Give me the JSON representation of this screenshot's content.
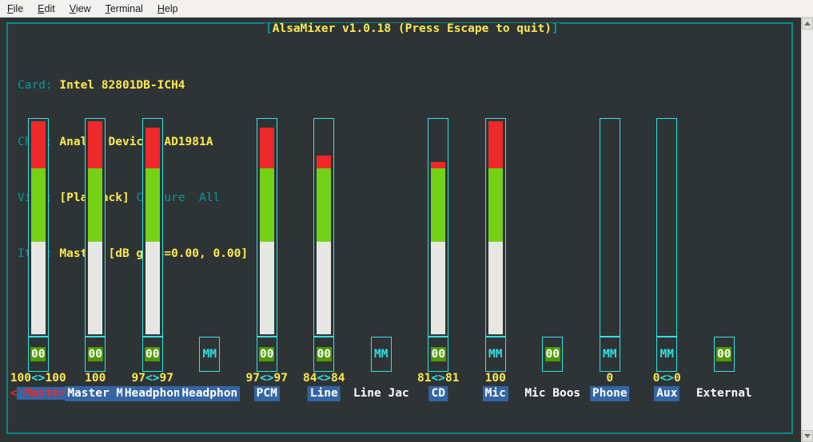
{
  "menu": {
    "items": [
      {
        "label": "File",
        "mnemonic": "F"
      },
      {
        "label": "Edit",
        "mnemonic": "E"
      },
      {
        "label": "View",
        "mnemonic": "V"
      },
      {
        "label": "Terminal",
        "mnemonic": "T"
      },
      {
        "label": "Help",
        "mnemonic": "H"
      }
    ]
  },
  "mixer": {
    "title": "AlsaMixer v1.0.18 (Press Escape to quit)",
    "title_open_bracket": "[",
    "title_close_bracket": "]",
    "info": {
      "card_label": "Card:",
      "card_value": "Intel 82801DB-ICH4",
      "chip_label": "Chip:",
      "chip_value": "Analog Devices AD1981A",
      "view_label": "View:",
      "view_selected": "[Playback]",
      "view_option_capture": "Capture",
      "view_option_all": "All",
      "item_label": "Item:",
      "item_value": "Master [dB gain=0.00, 0.00]"
    },
    "channels": [
      {
        "name": "Master",
        "label": "Master",
        "selected": true,
        "left_arrow": "<",
        "right_arrow": ">",
        "value_text": "100",
        "value_sep": "<>",
        "value_text2": "100",
        "volume": 100,
        "has_bar": true,
        "mute_tag": "00",
        "muted": false
      },
      {
        "name": "Master Mono",
        "label": "Master M",
        "selected": false,
        "value_text": "100",
        "value_sep": "",
        "value_text2": "",
        "volume": 100,
        "has_bar": true,
        "mute_tag": "00",
        "muted": false
      },
      {
        "name": "Headphone",
        "label": "Headphon",
        "selected": false,
        "value_text": "97",
        "value_sep": "<>",
        "value_text2": "97",
        "volume": 97,
        "has_bar": true,
        "mute_tag": "00",
        "muted": false
      },
      {
        "name": "Headphone 2",
        "label": "Headphon",
        "selected": false,
        "value_text": "",
        "value_sep": "",
        "value_text2": "",
        "volume": 0,
        "has_bar": false,
        "mute_tag": "MM",
        "muted": true
      },
      {
        "name": "PCM",
        "label": "PCM",
        "selected": false,
        "value_text": "97",
        "value_sep": "<>",
        "value_text2": "97",
        "volume": 97,
        "has_bar": true,
        "mute_tag": "00",
        "muted": false
      },
      {
        "name": "Line",
        "label": "Line",
        "selected": false,
        "value_text": "84",
        "value_sep": "<>",
        "value_text2": "84",
        "volume": 84,
        "has_bar": true,
        "mute_tag": "00",
        "muted": false
      },
      {
        "name": "Line Jack",
        "label": "Line Jac",
        "selected": false,
        "value_text": "",
        "value_sep": "",
        "value_text2": "",
        "volume": 0,
        "has_bar": false,
        "mute_tag": "MM",
        "muted": true
      },
      {
        "name": "CD",
        "label": "CD",
        "selected": false,
        "value_text": "81",
        "value_sep": "<>",
        "value_text2": "81",
        "volume": 81,
        "has_bar": true,
        "mute_tag": "00",
        "muted": false
      },
      {
        "name": "Mic",
        "label": "Mic",
        "selected": false,
        "value_text": "100",
        "value_sep": "",
        "value_text2": "",
        "volume": 100,
        "has_bar": true,
        "mute_tag": "MM",
        "muted": true
      },
      {
        "name": "Mic Boost",
        "label": "Mic Boos",
        "selected": false,
        "value_text": "",
        "value_sep": "",
        "value_text2": "",
        "volume": 0,
        "has_bar": false,
        "mute_tag": "00",
        "muted": false
      },
      {
        "name": "Phone",
        "label": "Phone",
        "selected": false,
        "value_text": "0",
        "value_sep": "",
        "value_text2": "",
        "volume": 0,
        "has_bar": true,
        "mute_tag": "MM",
        "muted": true
      },
      {
        "name": "Aux",
        "label": "Aux",
        "selected": false,
        "value_text": "0",
        "value_sep": "<>",
        "value_text2": "0",
        "volume": 0,
        "has_bar": true,
        "mute_tag": "MM",
        "muted": true
      },
      {
        "name": "External",
        "label": "External",
        "selected": false,
        "value_text": "",
        "value_sep": "",
        "value_text2": "",
        "volume": 0,
        "has_bar": false,
        "mute_tag": "00",
        "muted": false
      }
    ]
  },
  "colors": {
    "terminal_bg": "#2e3436",
    "frame": "#0a8a8a",
    "bar_border": "#34e2e2",
    "accent_yellow": "#fce94f",
    "accent_cyan": "#06989a",
    "label_bg": "#3465a4",
    "selected_red": "#ef2929",
    "fill_green": "#73d216",
    "fill_red": "#ef2929",
    "fill_white": "#e6e6e3",
    "mute_on_bg": "#4e9a06"
  },
  "scrollbar": {
    "up_arrow": "▲",
    "down_arrow": "▼"
  }
}
